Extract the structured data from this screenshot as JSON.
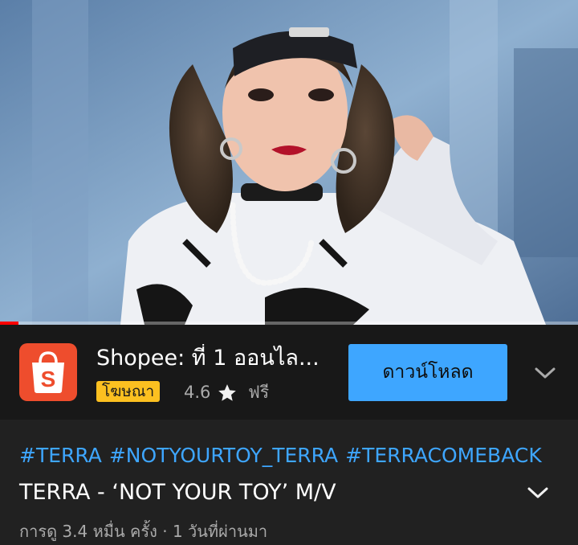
{
  "player": {
    "progress_fraction": 0.032
  },
  "ad": {
    "logo_icon": "shopee-bag-icon",
    "logo_letter": "S",
    "title": "Shopee: ที่ 1 ออนไล...",
    "badge": "โฆษณา",
    "rating": "4.6",
    "star_icon": "star-icon",
    "price": "ฟรี",
    "button_label": "ดาวน์โหลด",
    "expand_icon": "chevron-down-icon",
    "colors": {
      "brand": "#ee4d2d",
      "button": "#3ea6ff",
      "badge": "#fcc020"
    }
  },
  "video": {
    "hashtags": [
      "#TERRA",
      "#NOTYOURTOY_TERRA",
      "#TERRACOMEBACK"
    ],
    "title": "TERRA - ‘NOT YOUR TOY’ M/V",
    "meta": "การดู 3.4 หมื่น ครั้ง · 1 วันที่ผ่านมา",
    "expand_icon": "chevron-down-icon"
  }
}
